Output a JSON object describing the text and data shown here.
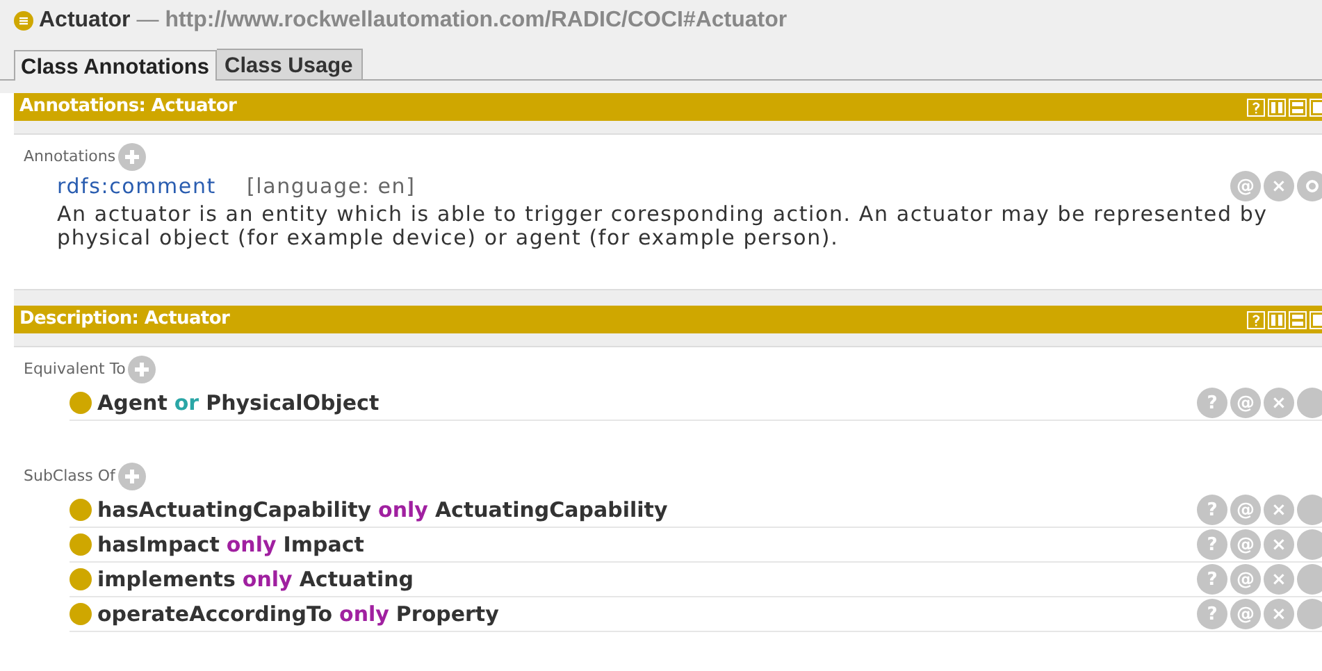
{
  "header": {
    "name": "Actuator",
    "separator": "—",
    "iri": "http://www.rockwellautomation.com/RADIC/COCI#Actuator"
  },
  "tabs": [
    {
      "label": "Class Annotations",
      "selected": true
    },
    {
      "label": "Class Usage",
      "selected": false
    }
  ],
  "annotations_panel": {
    "title": "Annotations: Actuator",
    "section_label": "Annotations",
    "items": [
      {
        "property": "rdfs:comment",
        "language": "[language: en]",
        "actions": [
          "@",
          "×"
        ],
        "value": "An actuator is an entity which is able to trigger coresponding action. An actuator may be represented by physical object (for example device) or agent (for example person)."
      }
    ]
  },
  "description_panel": {
    "title": "Description: Actuator",
    "sections": [
      {
        "label": "Equivalent To",
        "items": [
          {
            "actions": [
              "?",
              "@",
              "×"
            ],
            "tokens": [
              {
                "kind": "name",
                "text": "Agent"
              },
              {
                "kind": "keyword",
                "text": "or",
                "color": "#2aa6a6"
              },
              {
                "kind": "name",
                "text": "PhysicalObject"
              }
            ]
          }
        ]
      },
      {
        "label": "SubClass Of",
        "items": [
          {
            "actions": [
              "?",
              "@",
              "×"
            ],
            "tokens": [
              {
                "kind": "name",
                "text": "hasActuatingCapability"
              },
              {
                "kind": "keyword",
                "text": "only",
                "color": "#a020a0"
              },
              {
                "kind": "name",
                "text": "ActuatingCapability"
              }
            ]
          },
          {
            "actions": [
              "?",
              "@",
              "×"
            ],
            "tokens": [
              {
                "kind": "name",
                "text": "hasImpact"
              },
              {
                "kind": "keyword",
                "text": "only",
                "color": "#a020a0"
              },
              {
                "kind": "name",
                "text": "Impact"
              }
            ]
          },
          {
            "actions": [
              "?",
              "@",
              "×"
            ],
            "tokens": [
              {
                "kind": "name",
                "text": "implements"
              },
              {
                "kind": "keyword",
                "text": "only",
                "color": "#a020a0"
              },
              {
                "kind": "name",
                "text": "Actuating"
              }
            ]
          },
          {
            "actions": [
              "?",
              "@",
              "×"
            ],
            "tokens": [
              {
                "kind": "name",
                "text": "operateAccordingTo"
              },
              {
                "kind": "keyword",
                "text": "only",
                "color": "#a020a0"
              },
              {
                "kind": "name",
                "text": "Property"
              }
            ]
          }
        ]
      }
    ]
  }
}
